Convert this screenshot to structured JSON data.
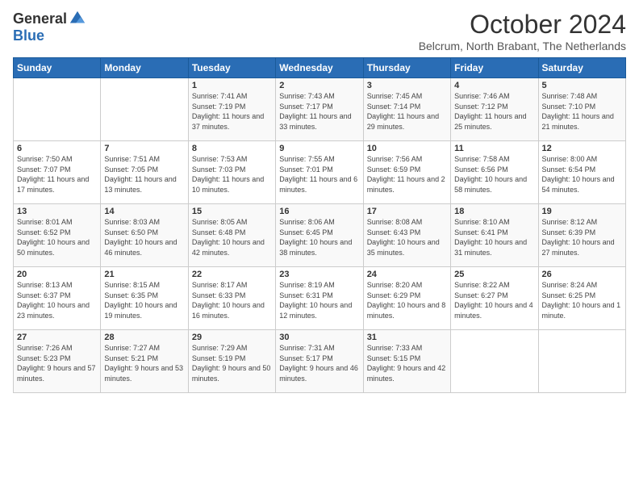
{
  "logo": {
    "general": "General",
    "blue": "Blue"
  },
  "title": "October 2024",
  "subtitle": "Belcrum, North Brabant, The Netherlands",
  "days_header": [
    "Sunday",
    "Monday",
    "Tuesday",
    "Wednesday",
    "Thursday",
    "Friday",
    "Saturday"
  ],
  "weeks": [
    [
      {
        "num": "",
        "info": ""
      },
      {
        "num": "",
        "info": ""
      },
      {
        "num": "1",
        "info": "Sunrise: 7:41 AM\nSunset: 7:19 PM\nDaylight: 11 hours and 37 minutes."
      },
      {
        "num": "2",
        "info": "Sunrise: 7:43 AM\nSunset: 7:17 PM\nDaylight: 11 hours and 33 minutes."
      },
      {
        "num": "3",
        "info": "Sunrise: 7:45 AM\nSunset: 7:14 PM\nDaylight: 11 hours and 29 minutes."
      },
      {
        "num": "4",
        "info": "Sunrise: 7:46 AM\nSunset: 7:12 PM\nDaylight: 11 hours and 25 minutes."
      },
      {
        "num": "5",
        "info": "Sunrise: 7:48 AM\nSunset: 7:10 PM\nDaylight: 11 hours and 21 minutes."
      }
    ],
    [
      {
        "num": "6",
        "info": "Sunrise: 7:50 AM\nSunset: 7:07 PM\nDaylight: 11 hours and 17 minutes."
      },
      {
        "num": "7",
        "info": "Sunrise: 7:51 AM\nSunset: 7:05 PM\nDaylight: 11 hours and 13 minutes."
      },
      {
        "num": "8",
        "info": "Sunrise: 7:53 AM\nSunset: 7:03 PM\nDaylight: 11 hours and 10 minutes."
      },
      {
        "num": "9",
        "info": "Sunrise: 7:55 AM\nSunset: 7:01 PM\nDaylight: 11 hours and 6 minutes."
      },
      {
        "num": "10",
        "info": "Sunrise: 7:56 AM\nSunset: 6:59 PM\nDaylight: 11 hours and 2 minutes."
      },
      {
        "num": "11",
        "info": "Sunrise: 7:58 AM\nSunset: 6:56 PM\nDaylight: 10 hours and 58 minutes."
      },
      {
        "num": "12",
        "info": "Sunrise: 8:00 AM\nSunset: 6:54 PM\nDaylight: 10 hours and 54 minutes."
      }
    ],
    [
      {
        "num": "13",
        "info": "Sunrise: 8:01 AM\nSunset: 6:52 PM\nDaylight: 10 hours and 50 minutes."
      },
      {
        "num": "14",
        "info": "Sunrise: 8:03 AM\nSunset: 6:50 PM\nDaylight: 10 hours and 46 minutes."
      },
      {
        "num": "15",
        "info": "Sunrise: 8:05 AM\nSunset: 6:48 PM\nDaylight: 10 hours and 42 minutes."
      },
      {
        "num": "16",
        "info": "Sunrise: 8:06 AM\nSunset: 6:45 PM\nDaylight: 10 hours and 38 minutes."
      },
      {
        "num": "17",
        "info": "Sunrise: 8:08 AM\nSunset: 6:43 PM\nDaylight: 10 hours and 35 minutes."
      },
      {
        "num": "18",
        "info": "Sunrise: 8:10 AM\nSunset: 6:41 PM\nDaylight: 10 hours and 31 minutes."
      },
      {
        "num": "19",
        "info": "Sunrise: 8:12 AM\nSunset: 6:39 PM\nDaylight: 10 hours and 27 minutes."
      }
    ],
    [
      {
        "num": "20",
        "info": "Sunrise: 8:13 AM\nSunset: 6:37 PM\nDaylight: 10 hours and 23 minutes."
      },
      {
        "num": "21",
        "info": "Sunrise: 8:15 AM\nSunset: 6:35 PM\nDaylight: 10 hours and 19 minutes."
      },
      {
        "num": "22",
        "info": "Sunrise: 8:17 AM\nSunset: 6:33 PM\nDaylight: 10 hours and 16 minutes."
      },
      {
        "num": "23",
        "info": "Sunrise: 8:19 AM\nSunset: 6:31 PM\nDaylight: 10 hours and 12 minutes."
      },
      {
        "num": "24",
        "info": "Sunrise: 8:20 AM\nSunset: 6:29 PM\nDaylight: 10 hours and 8 minutes."
      },
      {
        "num": "25",
        "info": "Sunrise: 8:22 AM\nSunset: 6:27 PM\nDaylight: 10 hours and 4 minutes."
      },
      {
        "num": "26",
        "info": "Sunrise: 8:24 AM\nSunset: 6:25 PM\nDaylight: 10 hours and 1 minute."
      }
    ],
    [
      {
        "num": "27",
        "info": "Sunrise: 7:26 AM\nSunset: 5:23 PM\nDaylight: 9 hours and 57 minutes."
      },
      {
        "num": "28",
        "info": "Sunrise: 7:27 AM\nSunset: 5:21 PM\nDaylight: 9 hours and 53 minutes."
      },
      {
        "num": "29",
        "info": "Sunrise: 7:29 AM\nSunset: 5:19 PM\nDaylight: 9 hours and 50 minutes."
      },
      {
        "num": "30",
        "info": "Sunrise: 7:31 AM\nSunset: 5:17 PM\nDaylight: 9 hours and 46 minutes."
      },
      {
        "num": "31",
        "info": "Sunrise: 7:33 AM\nSunset: 5:15 PM\nDaylight: 9 hours and 42 minutes."
      },
      {
        "num": "",
        "info": ""
      },
      {
        "num": "",
        "info": ""
      }
    ]
  ]
}
